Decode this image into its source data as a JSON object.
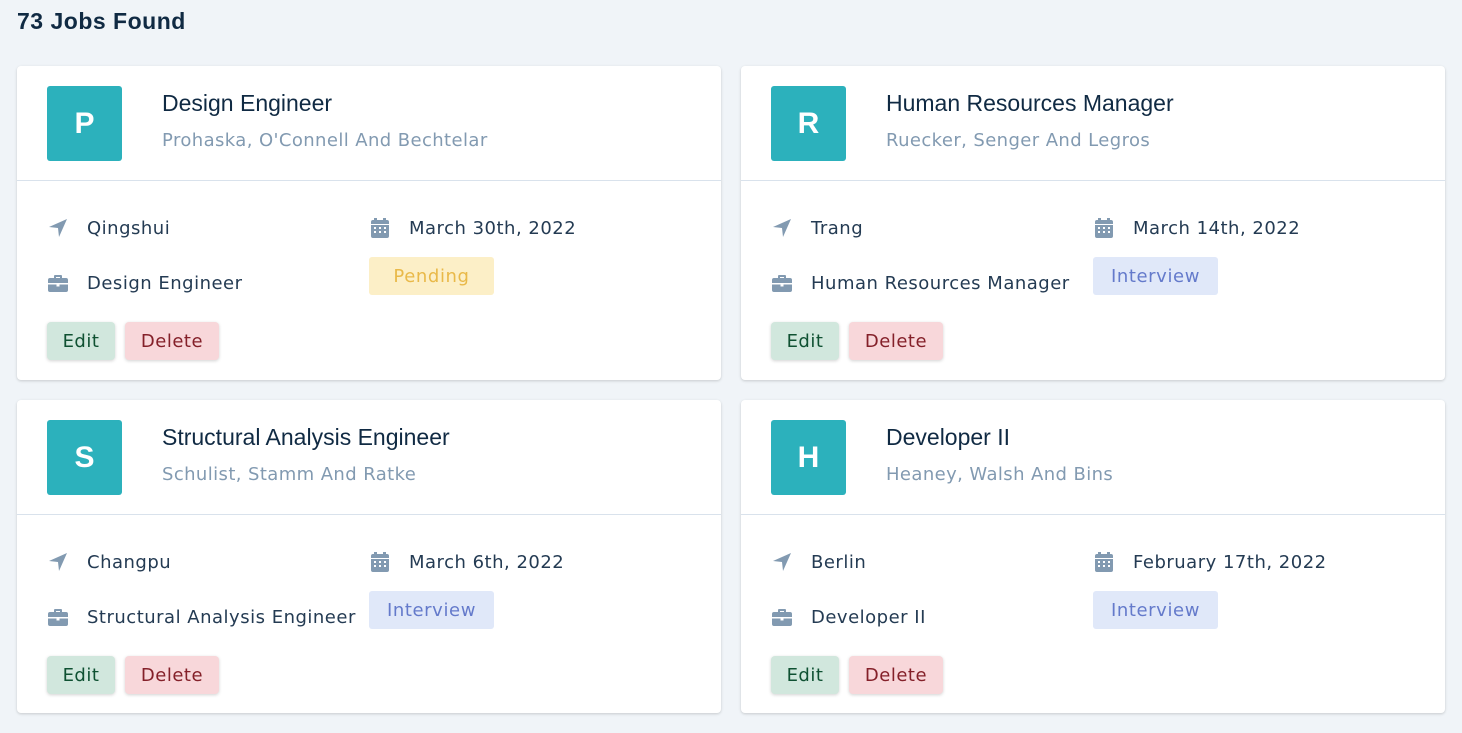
{
  "results": {
    "title": "73 Jobs Found"
  },
  "jobs": [
    {
      "initial": "P",
      "position": "Design Engineer",
      "company": "Prohaska, O'Connell And Bechtelar",
      "location": "Qingshui",
      "job_type": "Design Engineer",
      "date": "March 30th, 2022",
      "status": "Pending",
      "edit_label": "Edit",
      "delete_label": "Delete"
    },
    {
      "initial": "R",
      "position": "Human Resources Manager",
      "company": "Ruecker, Senger And Legros",
      "location": "Trang",
      "job_type": "Human Resources Manager",
      "date": "March 14th, 2022",
      "status": "Interview",
      "edit_label": "Edit",
      "delete_label": "Delete"
    },
    {
      "initial": "S",
      "position": "Structural Analysis Engineer",
      "company": "Schulist, Stamm And Ratke",
      "location": "Changpu",
      "job_type": "Structural Analysis Engineer",
      "date": "March 6th, 2022",
      "status": "Interview",
      "edit_label": "Edit",
      "delete_label": "Delete"
    },
    {
      "initial": "H",
      "position": "Developer II",
      "company": "Heaney, Walsh And Bins",
      "location": "Berlin",
      "job_type": "Developer II",
      "date": "February 17th, 2022",
      "status": "Interview",
      "edit_label": "Edit",
      "delete_label": "Delete"
    }
  ],
  "icons": {
    "location": "location-arrow-icon",
    "job_type": "briefcase-icon",
    "date": "calendar-icon"
  },
  "colors": {
    "avatar": "#2cb1bc",
    "pending_bg": "#fcefc7",
    "pending_text": "#e9b949",
    "interview_bg": "#e0e8f9",
    "interview_text": "#647acb",
    "edit_bg": "#d1e7dd",
    "delete_bg": "#f8d7da"
  }
}
